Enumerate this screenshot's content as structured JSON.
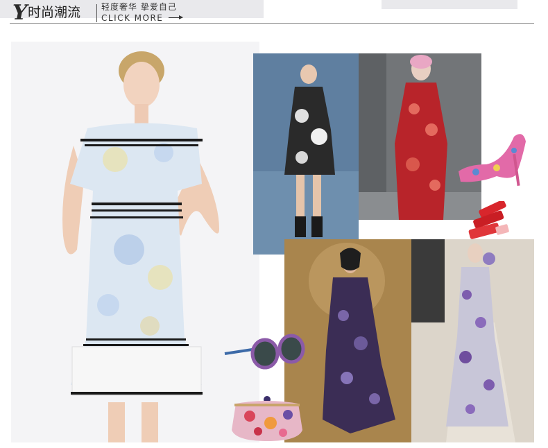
{
  "header": {
    "logo_letter": "Y",
    "title": "时尚潮流",
    "subtitle": "轻度奢华 挚爱自己",
    "cta": "CLICK MORE"
  },
  "colors": {
    "rule": "#8a8a8a",
    "band": "#e9e9ec",
    "text": "#2b2b2b"
  },
  "images": [
    {
      "name": "model-white-floral-dress",
      "alt": ""
    },
    {
      "name": "runway-black-floral-dress",
      "alt": ""
    },
    {
      "name": "runway-red-floral-gown",
      "alt": ""
    },
    {
      "name": "floral-stiletto-pump",
      "alt": ""
    },
    {
      "name": "red-lipsticks",
      "alt": ""
    },
    {
      "name": "runway-purple-floral-cape",
      "alt": ""
    },
    {
      "name": "runway-lavender-floral-gown",
      "alt": ""
    },
    {
      "name": "floral-sunglasses",
      "alt": ""
    },
    {
      "name": "floral-clutch-bag",
      "alt": ""
    }
  ]
}
